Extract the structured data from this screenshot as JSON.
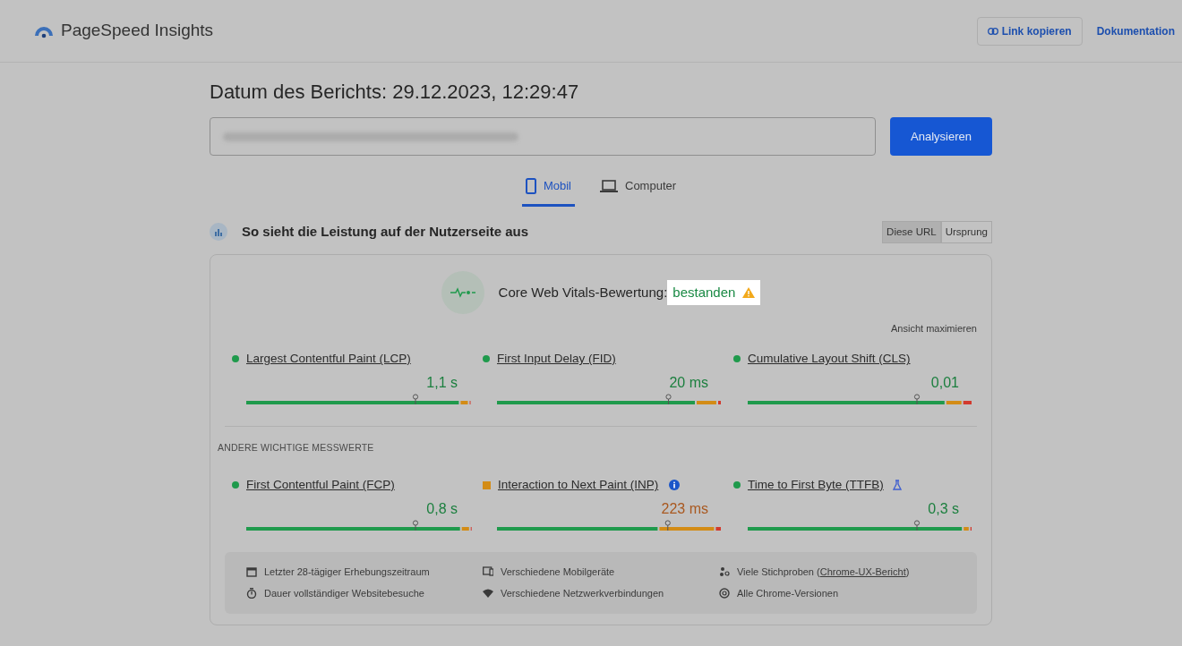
{
  "header": {
    "app_name": "PageSpeed Insights",
    "actions": [
      {
        "label": "Link kopieren",
        "kind": "outlined"
      },
      {
        "label": "Dokumentation",
        "kind": "text"
      }
    ]
  },
  "report_date": "Datum des Berichts: 29.12.2023, 12:29:47",
  "url_input": {
    "redacted": true
  },
  "analyze_button": "Analysieren",
  "device_tabs": [
    {
      "label": "Mobil",
      "kind": "phone",
      "selected": true
    },
    {
      "label": "Computer",
      "kind": "laptop",
      "selected": false
    }
  ],
  "field_section": {
    "title": "So sieht die Leistung auf der Nutzerseite aus",
    "scope_toggle": [
      {
        "label": "Diese URL",
        "selected": true
      },
      {
        "label": "Ursprung",
        "selected": false
      }
    ]
  },
  "assessment": {
    "label": "Core Web Vitals-Bewertung:",
    "status": "bestanden",
    "passed": true,
    "spotlight": true,
    "warning": true
  },
  "expand_link": "Ansicht maximieren",
  "core_metrics": [
    {
      "name": "Largest Contentful Paint (LCP)",
      "value": "1,1 s",
      "color": "#1f9a4c",
      "marker": {
        "level": 0.75
      }
    },
    {
      "name": "First Input Delay (FID)",
      "value": "20 ms",
      "color": "#1f9a4c",
      "marker": {
        "level": 0.76
      }
    },
    {
      "name": "Cumulative Layout Shift (CLS)",
      "value": "0,01",
      "color": "#1f9a4c",
      "marker": {
        "level": 0.75
      }
    }
  ],
  "other_heading": "ANDERE WICHTIGE MESSWERTE",
  "other_metrics": [
    {
      "name": "First Contentful Paint (FCP)",
      "value": "0,8 s",
      "color": "#1f9a4c",
      "marker": {
        "level": 0.75
      }
    },
    {
      "name": "Interaction to Next Paint (INP)",
      "value": "223 ms",
      "color": "#d38c16",
      "kind": "info",
      "marker": {
        "level": 0.757
      }
    },
    {
      "name": "Time to First Byte (TTFB)",
      "value": "0,3 s",
      "color": "#1f9a4c",
      "kind": "experimental",
      "marker": {
        "level": 0.75
      }
    }
  ],
  "footer_notes": [
    {
      "kind": "calendar",
      "text": "Letzter 28-tägiger Erhebungszeitraum"
    },
    {
      "kind": "devices",
      "text": "Verschiedene Mobilgeräte"
    },
    {
      "kind": "samples",
      "text": "Viele Stichproben (",
      "link": "Chrome-UX-Bericht",
      "after": ")"
    },
    {
      "kind": "timer",
      "text": "Dauer vollständiger Websitebesuche"
    },
    {
      "kind": "wifi",
      "text": "Verschiedene Netzwerkverbindungen"
    },
    {
      "kind": "browser",
      "text": "Alle Chrome-Versionen"
    }
  ]
}
